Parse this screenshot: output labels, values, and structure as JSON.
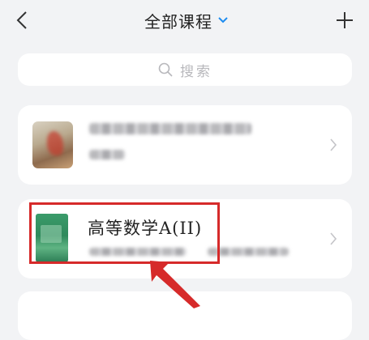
{
  "header": {
    "title": "全部课程",
    "icons": {
      "back": "chevron-left-icon",
      "dropdown": "chevron-down-icon",
      "add": "plus-icon"
    }
  },
  "search": {
    "placeholder": "搜索",
    "icon": "search-icon"
  },
  "courses": [
    {
      "title": "",
      "redacted": true,
      "thumbnail": "course-cover-image"
    },
    {
      "title": "高等数学A(II)",
      "redacted_subtitle": true,
      "thumbnail": "course-cover-image",
      "highlighted": true
    }
  ],
  "colors": {
    "accent": "#1e8cf0",
    "highlight": "#d62a2a",
    "background": "#f2f3f5"
  }
}
